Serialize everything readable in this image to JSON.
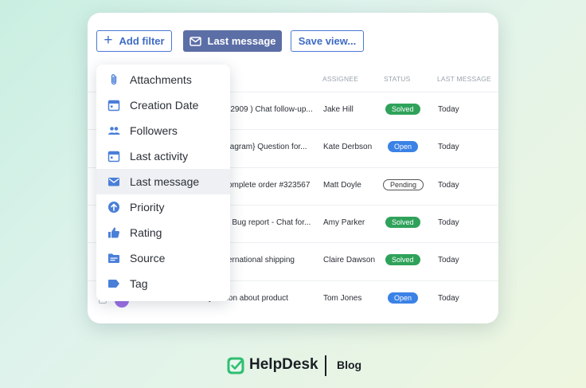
{
  "toolbar": {
    "add_filter_label": "Add filter",
    "last_message_label": "Last message",
    "save_view_label": "Save view..."
  },
  "table": {
    "columns": [
      "ASSIGNEE",
      "STATUS",
      "LAST MESSAGE"
    ],
    "rows": [
      {
        "subject": "-2909 ) Chat follow-up...",
        "assignee": "Jake Hill",
        "status": "Solved",
        "date": "Today"
      },
      {
        "subject": "tagram} Question for...",
        "assignee": "Kate Derbson",
        "status": "Open",
        "date": "Today"
      },
      {
        "subject": "omplete order #323567",
        "assignee": "Matt Doyle",
        "status": "Pending",
        "date": "Today"
      },
      {
        "subject": "| Bug report - Chat for...",
        "assignee": "Amy Parker",
        "status": "Solved",
        "date": "Today"
      },
      {
        "subject": "ernational shipping",
        "assignee": "Claire Dawson",
        "status": "Solved",
        "date": "Today"
      },
      {
        "subject": "Question about product",
        "assignee": "Tom Jones",
        "status": "Open",
        "date": "Today"
      }
    ]
  },
  "menu": {
    "items": [
      {
        "label": "Attachments",
        "icon": "paperclip-icon"
      },
      {
        "label": "Creation Date",
        "icon": "calendar-icon"
      },
      {
        "label": "Followers",
        "icon": "people-icon"
      },
      {
        "label": "Last activity",
        "icon": "calendar-icon"
      },
      {
        "label": "Last message",
        "icon": "envelope-icon"
      },
      {
        "label": "Priority",
        "icon": "arrow-up-circle-icon"
      },
      {
        "label": "Rating",
        "icon": "thumbs-up-icon"
      },
      {
        "label": "Source",
        "icon": "folder-icon"
      },
      {
        "label": "Tag",
        "icon": "tag-icon"
      }
    ],
    "active_label": "Last message"
  },
  "footer": {
    "brand": "HelpDesk",
    "section": "Blog"
  },
  "colors": {
    "accent": "#4a78d6",
    "primary_button": "#5b6ea6",
    "solved": "#2fa25a",
    "open": "#3b82e6",
    "brand_green": "#2fbf71"
  }
}
